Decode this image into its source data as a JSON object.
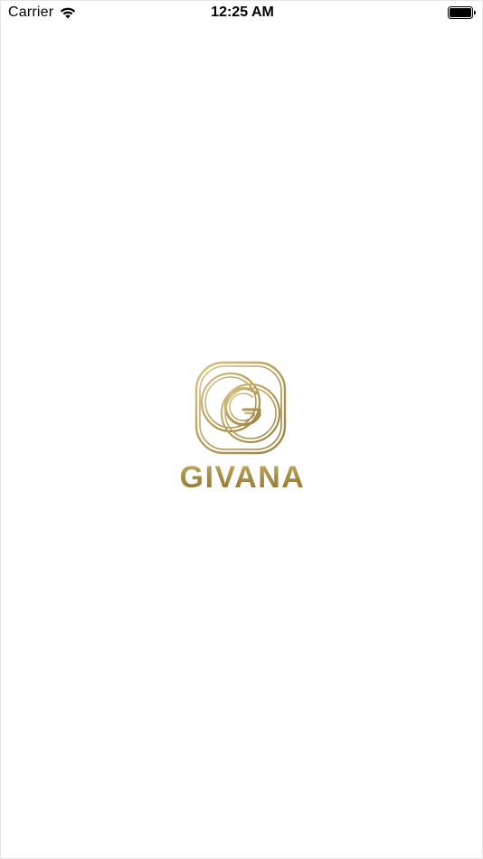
{
  "status_bar": {
    "carrier": "Carrier",
    "time": "12:25 AM",
    "wifi_icon": "wifi-icon",
    "battery_icon": "battery-icon"
  },
  "splash": {
    "logo_icon": "givana-g-logo-icon",
    "brand_name": "GIVANA",
    "brand_color": "#a99149",
    "background_color": "#ffffff"
  }
}
